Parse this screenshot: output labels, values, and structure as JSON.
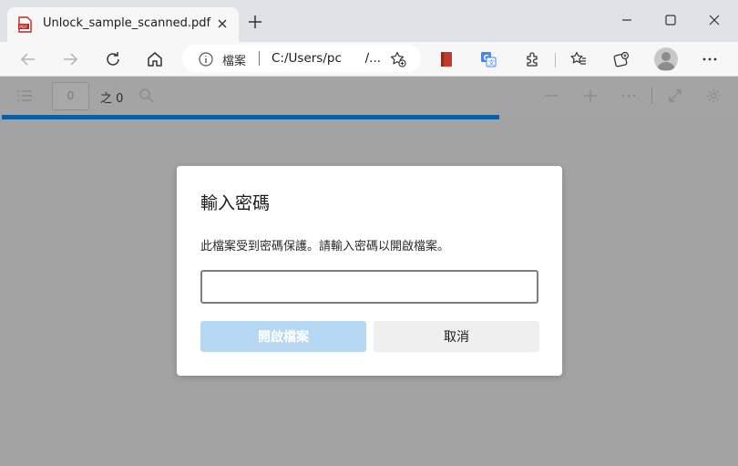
{
  "tab": {
    "title": "Unlock_sample_scanned.pdf"
  },
  "address": {
    "site_label": "檔案",
    "url": "C:/Users/pc      /..."
  },
  "pdf_toolbar": {
    "page_input_value": "0",
    "page_total": "之 0"
  },
  "dialog": {
    "title": "輸入密碼",
    "message": "此檔案受到密碼保護。請輸入密碼以開啟檔案。",
    "password_value": "",
    "open_button": "開啟檔案",
    "cancel_button": "取消"
  },
  "colors": {
    "accent": "#0b5fa4",
    "primary_disabled": "#b7d8f3",
    "viewer_background": "#a3a3a3"
  },
  "icons": [
    "pdf-file-icon",
    "close-icon",
    "plus-icon",
    "minimize-icon",
    "maximize-icon",
    "back-icon",
    "forward-icon",
    "refresh-icon",
    "home-icon",
    "info-icon",
    "add-favorite-icon",
    "book-extension-icon",
    "translate-icon",
    "extensions-icon",
    "favorites-icon",
    "collections-icon",
    "profile-icon",
    "more-icon",
    "outline-icon",
    "search-icon",
    "zoom-out-icon",
    "zoom-in-icon",
    "fit-page-icon",
    "settings-icon"
  ]
}
